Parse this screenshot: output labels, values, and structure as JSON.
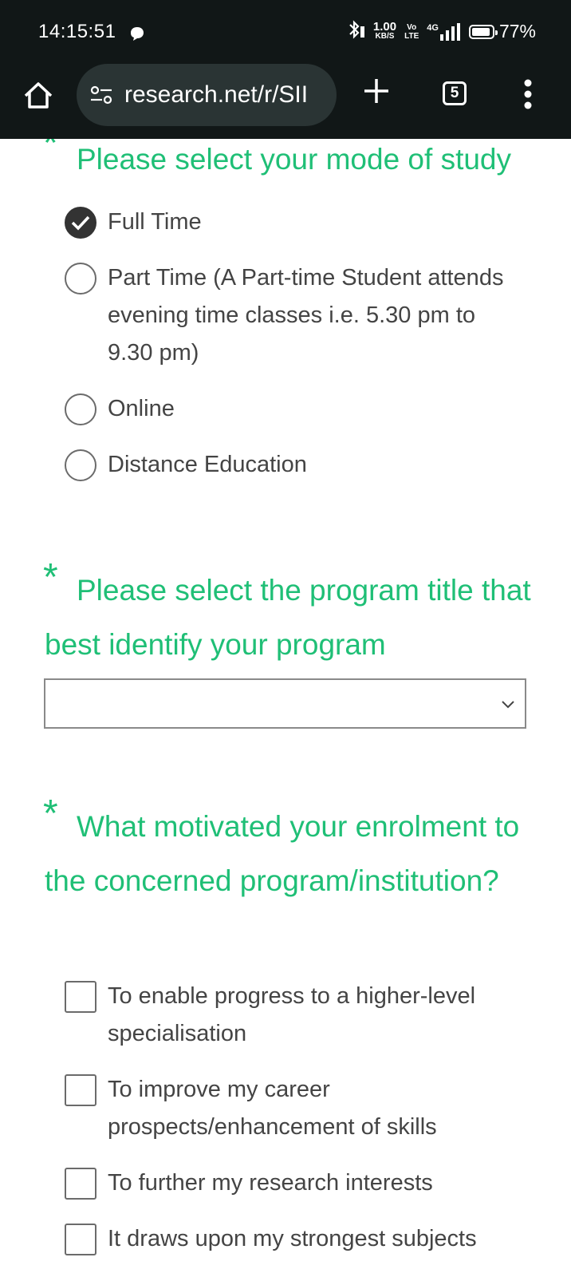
{
  "status_bar": {
    "time": "14:15:51",
    "net_speed_value": "1.00",
    "net_speed_unit": "KB/S",
    "volte_top": "Vo",
    "volte_bottom": "LTE",
    "network": "4G",
    "battery": "77%",
    "battery_level": 0.77
  },
  "browser": {
    "url": "research.net/r/SII",
    "tab_count": "5",
    "icons": [
      "home-icon",
      "site-settings-icon",
      "plus-icon",
      "tabs-icon",
      "more-vert-icon"
    ]
  },
  "survey": {
    "q1": {
      "required_mark": "*",
      "title": "Please select your mode of study",
      "options": [
        {
          "label": "Full Time",
          "checked": true
        },
        {
          "label": "Part Time (A Part-time Student attends evening time classes i.e. 5.30 pm to 9.30 pm)",
          "checked": false
        },
        {
          "label": "Online",
          "checked": false
        },
        {
          "label": "Distance Education",
          "checked": false
        }
      ]
    },
    "q2": {
      "required_mark": "*",
      "title": "Please select the program title that best identify your program",
      "selected_value": ""
    },
    "q3": {
      "required_mark": "*",
      "title": "What motivated your enrolment to the concerned program/institution?",
      "options": [
        {
          "label": "To enable progress to a higher-level specialisation",
          "checked": false
        },
        {
          "label": "To improve my career prospects/enhancement of skills",
          "checked": false
        },
        {
          "label": "To further my research interests",
          "checked": false
        },
        {
          "label": "It draws upon my strongest subjects",
          "checked": false
        }
      ]
    }
  },
  "colors": {
    "accent_green": "#1fbf76",
    "top_bar": "#111717",
    "url_pill": "#2a3434",
    "text": "#444444"
  }
}
